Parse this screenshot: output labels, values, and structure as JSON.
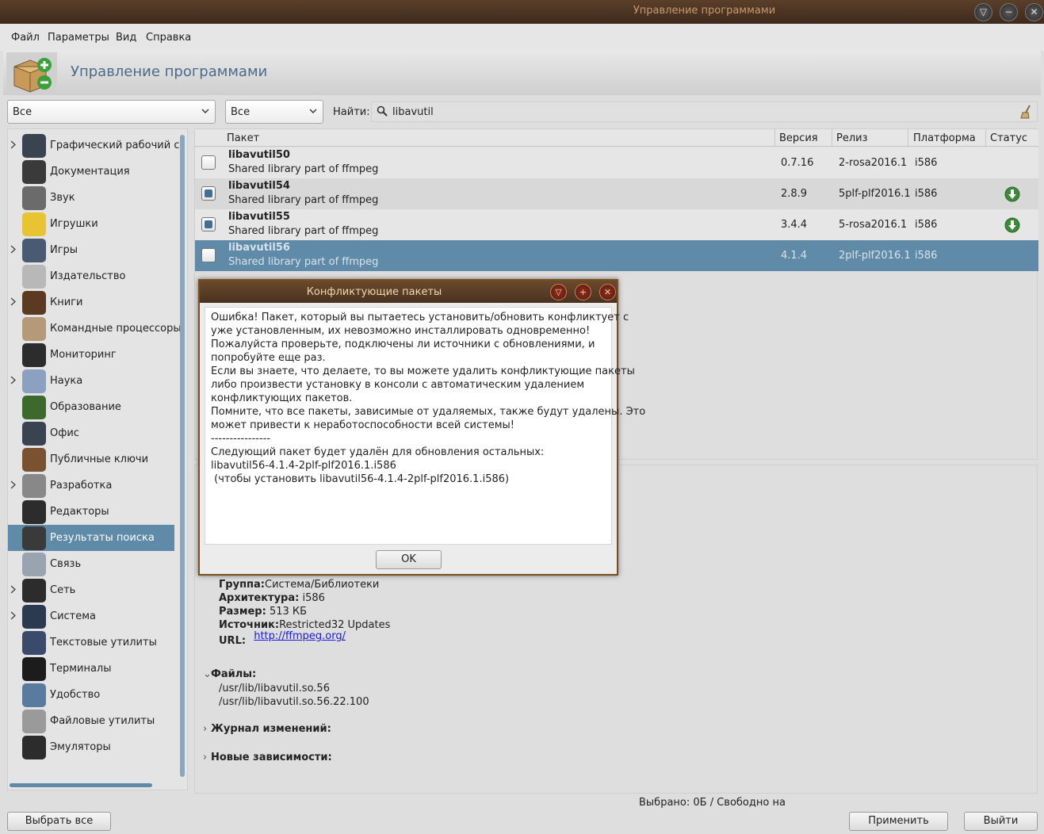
{
  "window": {
    "title": "Управление программами",
    "buttons": [
      "▽",
      "−",
      "✕"
    ]
  },
  "menu": [
    "Файл",
    "Параметры",
    "Вид",
    "Справка"
  ],
  "header": {
    "title": "Управление программами"
  },
  "filters": {
    "group": "Все",
    "status": "Все",
    "find_label": "Найти:",
    "search_value": "libavutil"
  },
  "categories": [
    {
      "label": "Графический рабочий с",
      "expandable": true,
      "icon": "desktop-icon",
      "color": "#3a4450"
    },
    {
      "label": "Документация",
      "expandable": false,
      "icon": "documentation-icon",
      "color": "#3a3a3a"
    },
    {
      "label": "Звук",
      "expandable": false,
      "icon": "speaker-icon",
      "color": "#6b6b6b"
    },
    {
      "label": "Игрушки",
      "expandable": false,
      "icon": "smiley-icon",
      "color": "#e8c432"
    },
    {
      "label": "Игры",
      "expandable": true,
      "icon": "gamepad-icon",
      "color": "#4a5a72"
    },
    {
      "label": "Издательство",
      "expandable": false,
      "icon": "publishing-icon",
      "color": "#b8b8b8"
    },
    {
      "label": "Книги",
      "expandable": true,
      "icon": "book-icon",
      "color": "#5a3a20"
    },
    {
      "label": "Командные процессоры",
      "expandable": false,
      "icon": "shell-icon",
      "color": "#b59a7a"
    },
    {
      "label": "Мониторинг",
      "expandable": false,
      "icon": "monitor-icon",
      "color": "#2c2c2c"
    },
    {
      "label": "Наука",
      "expandable": true,
      "icon": "science-icon",
      "color": "#8ca0c0"
    },
    {
      "label": "Образование",
      "expandable": false,
      "icon": "education-icon",
      "color": "#3c6a2c"
    },
    {
      "label": "Офис",
      "expandable": false,
      "icon": "office-icon",
      "color": "#3a4450"
    },
    {
      "label": "Публичные ключи",
      "expandable": false,
      "icon": "keys-icon",
      "color": "#7a5230"
    },
    {
      "label": "Разработка",
      "expandable": true,
      "icon": "tools-icon",
      "color": "#888888"
    },
    {
      "label": "Редакторы",
      "expandable": false,
      "icon": "editor-icon",
      "color": "#2c2c2c"
    },
    {
      "label": "Результаты поиска",
      "expandable": false,
      "icon": "search-results-icon",
      "color": "#3a3a3a",
      "selected": true
    },
    {
      "label": "Связь",
      "expandable": false,
      "icon": "communication-icon",
      "color": "#9aa4b0"
    },
    {
      "label": "Сеть",
      "expandable": true,
      "icon": "network-icon",
      "color": "#2c2c2c"
    },
    {
      "label": "Система",
      "expandable": true,
      "icon": "system-icon",
      "color": "#2c3a50"
    },
    {
      "label": "Текстовые утилиты",
      "expandable": false,
      "icon": "pen-icon",
      "color": "#3a4a6a"
    },
    {
      "label": "Терминалы",
      "expandable": false,
      "icon": "terminal-icon",
      "color": "#1c1c1c"
    },
    {
      "label": "Удобство",
      "expandable": false,
      "icon": "accessibility-icon",
      "color": "#5a7aa0"
    },
    {
      "label": "Файловые утилиты",
      "expandable": false,
      "icon": "file-tools-icon",
      "color": "#9a9a9a"
    },
    {
      "label": "Эмуляторы",
      "expandable": false,
      "icon": "emulator-icon",
      "color": "#2c2c2c"
    }
  ],
  "table": {
    "columns": [
      "Пакет",
      "Версия",
      "Релиз",
      "Платформа",
      "Статус"
    ],
    "rows": [
      {
        "name": "libavutil50",
        "desc": "Shared library part of ffmpeg",
        "version": "0.7.16",
        "release": "2-rosa2016.1",
        "platform": "i586",
        "checked": false,
        "installed": false
      },
      {
        "name": "libavutil54",
        "desc": "Shared library part of ffmpeg",
        "version": "2.8.9",
        "release": "5plf-plf2016.1",
        "platform": "i586",
        "checked": true,
        "installed": true
      },
      {
        "name": "libavutil55",
        "desc": "Shared library part of ffmpeg",
        "version": "3.4.4",
        "release": "5-rosa2016.1",
        "platform": "i586",
        "checked": true,
        "installed": true
      },
      {
        "name": "libavutil56",
        "desc": "Shared library part of ffmpeg",
        "version": "4.1.4",
        "release": "2plf-plf2016.1",
        "platform": "i586",
        "checked": false,
        "installed": false,
        "selected": true
      }
    ]
  },
  "details": {
    "group_label": "Группа:",
    "group_value": "Система/Библиотеки",
    "arch_label": "Архитектура:",
    "arch_value": " i586",
    "size_label": "Размер:",
    "size_value": " 513 КБ",
    "source_label": "Источник:",
    "source_value": "Restricted32 Updates",
    "url_label": "URL:",
    "url_value": "http://ffmpeg.org/",
    "files_title": "Файлы:",
    "files": [
      "/usr/lib/libavutil.so.56",
      "/usr/lib/libavutil.so.56.22.100"
    ],
    "changelog_title": "Журнал изменений:",
    "deps_title": "Новые зависимости:"
  },
  "footer": {
    "status": "Выбрано: 0Б / Свободно на",
    "select_all": "Выбрать все",
    "apply": "Применить",
    "exit": "Выйти"
  },
  "dialog": {
    "title": "Конфликтующие пакеты",
    "lines": [
      "Ошибка! Пакет, который вы пытаетесь установить/обновить конфликтует с",
      "уже установленным, их невозможно инсталлировать одновременно!",
      "Пожалуйста проверьте, подключены ли источники с обновлениями, и",
      "попробуйте еще раз.",
      "Если вы знаете, что делаете, то вы можете удалить конфликтующие пакеты",
      "либо произвести установку в консоли с автоматическим удалением",
      "конфликтующих пакетов.",
      "Помните, что все пакеты, зависимые от удаляемых, также будут удалены. Это",
      "может привести к неработоспособности всей системы!",
      "----------------",
      "Следующий пакет будет удалён для обновления остальных:",
      "libavutil56-4.1.4-2plf-plf2016.1.i586",
      " (чтобы установить libavutil56-4.1.4-2plf-plf2016.1.i586)"
    ],
    "ok": "OK"
  }
}
